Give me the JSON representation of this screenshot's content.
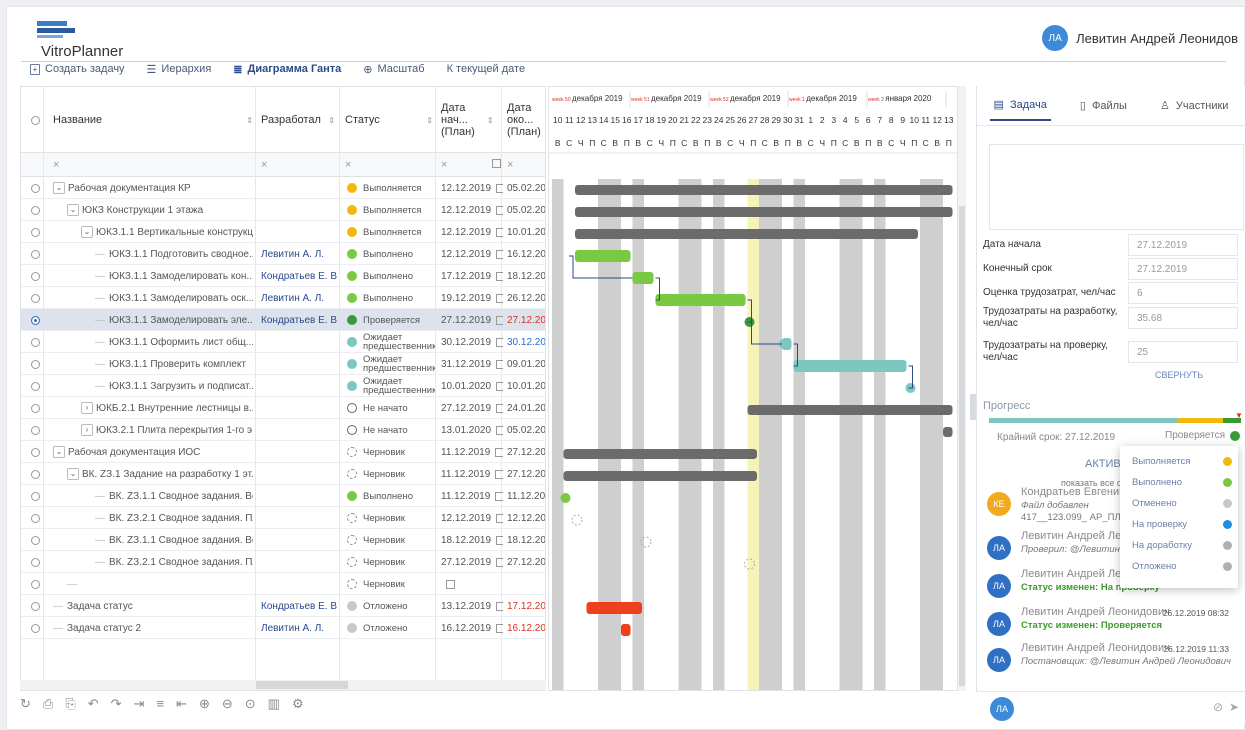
{
  "app": {
    "title": "VitroPlanner"
  },
  "user": {
    "initials": "ЛА",
    "name": "Левитин Андрей Леонидов"
  },
  "toolbar": {
    "create": "Создать задачу",
    "hierarchy": "Иерархия",
    "gantt": "Диаграмма Ганта",
    "scale": "Масштаб",
    "today": "К текущей дате"
  },
  "columns": {
    "name": "Название",
    "author": "Разработал",
    "status": "Статус",
    "start": "Дата нач... (План)",
    "end": "Дата око... (План)"
  },
  "filter_x": "×",
  "colors": {
    "in_progress": "#f2b80f",
    "done": "#7ac943",
    "review": "#3a9a3a",
    "waiting": "#7cc7c0",
    "cancelled": "#c8c8c8",
    "accent": "#2b4a8a",
    "overdue": "#e03020"
  },
  "rows": [
    {
      "name": "Рабочая документация КР",
      "author": "",
      "status": "Выполняется",
      "dot": "in_progress",
      "start": "12.12.2019",
      "end": "05.02.2020",
      "indent": 1,
      "exp": "v"
    },
    {
      "name": "ЮКЗ Конструкции 1 этажа",
      "author": "",
      "status": "Выполняется",
      "dot": "in_progress",
      "start": "12.12.2019",
      "end": "05.02.2020",
      "indent": 2,
      "exp": "v"
    },
    {
      "name": "ЮКЗ.1.1 Вертикальные конструкц...",
      "author": "",
      "status": "Выполняется",
      "dot": "in_progress",
      "start": "12.12.2019",
      "end": "10.01.2020",
      "indent": 3,
      "exp": "v"
    },
    {
      "name": "ЮКЗ.1.1 Подготовить сводное...",
      "author": "Левитин А. Л.",
      "status": "Выполнено",
      "dot": "done",
      "start": "12.12.2019",
      "end": "16.12.2019",
      "indent": 4
    },
    {
      "name": "ЮКЗ.1.1 Замоделировать кон...",
      "author": "Кондратьев Е. В.",
      "status": "Выполнено",
      "dot": "done",
      "start": "17.12.2019",
      "end": "18.12.2019",
      "indent": 4
    },
    {
      "name": "ЮКЗ.1.1 Замоделировать оск...",
      "author": "Левитин А. Л.",
      "status": "Выполнено",
      "dot": "done",
      "start": "19.12.2019",
      "end": "26.12.2019",
      "indent": 4
    },
    {
      "name": "ЮКЗ.1.1 Замоделировать эле...",
      "author": "Кондратьев Е. В.",
      "status": "Проверяется",
      "dot": "review",
      "start": "27.12.2019",
      "end": "27.12.2019",
      "indent": 4,
      "endColor": "red",
      "sel": true
    },
    {
      "name": "ЮКЗ.1.1 Оформить лист общ...",
      "author": "",
      "status": "Ожидает предшественника",
      "dot": "waiting",
      "start": "30.12.2019",
      "end": "30.12.2019",
      "indent": 4,
      "endColor": "blue"
    },
    {
      "name": "ЮКЗ.1.1 Проверить комплект",
      "author": "",
      "status": "Ожидает предшественника",
      "dot": "waiting",
      "start": "31.12.2019",
      "end": "09.01.2020",
      "indent": 4
    },
    {
      "name": "ЮКЗ.1.1 Загрузить и подписат...",
      "author": "",
      "status": "Ожидает предшественника",
      "dot": "waiting",
      "start": "10.01.2020",
      "end": "10.01.2020",
      "indent": 4
    },
    {
      "name": "ЮКБ.2.1 Внутренние лестницы в...",
      "author": "",
      "status": "Не начато",
      "dot": "open",
      "start": "27.12.2019",
      "end": "24.01.2020",
      "indent": 3,
      "exp": ">"
    },
    {
      "name": "ЮКЗ.2.1 Плита перекрытия 1-го э...",
      "author": "",
      "status": "Не начато",
      "dot": "open",
      "start": "13.01.2020",
      "end": "05.02.2020",
      "indent": 3,
      "exp": ">"
    },
    {
      "name": "Рабочая документация ИОС",
      "author": "",
      "status": "Черновик",
      "dot": "draft",
      "start": "11.12.2019",
      "end": "27.12.2019",
      "indent": 1,
      "exp": "v"
    },
    {
      "name": "ВК. ZЗ.1 Задание на разработку 1 эт...",
      "author": "",
      "status": "Черновик",
      "dot": "draft",
      "start": "11.12.2019",
      "end": "27.12.2019",
      "indent": 2,
      "exp": "v"
    },
    {
      "name": "ВК. ZЗ.1.1 Сводное задания. Вер...",
      "author": "",
      "status": "Выполнено",
      "dot": "done",
      "start": "11.12.2019",
      "end": "11.12.2019",
      "indent": 4
    },
    {
      "name": "ВК. ZЗ.2.1 Сводное задания. Пли...",
      "author": "",
      "status": "Черновик",
      "dot": "draft",
      "start": "12.12.2019",
      "end": "12.12.2019",
      "indent": 4
    },
    {
      "name": "ВК. ZЗ.1.1 Сводное задания. Вер ...",
      "author": "",
      "status": "Черновик",
      "dot": "draft",
      "start": "18.12.2019",
      "end": "18.12.2019",
      "indent": 4
    },
    {
      "name": "ВК. ZЗ.2.1 Сводное задания. Пли...",
      "author": "",
      "status": "Черновик",
      "dot": "draft",
      "start": "27.12.2019",
      "end": "27.12.2019",
      "indent": 4
    },
    {
      "name": "",
      "author": "",
      "status": "Черновик",
      "dot": "draft",
      "start": "",
      "end": "",
      "indent": 2
    },
    {
      "name": "Задача статус",
      "author": "Кондратьев Е. В.",
      "status": "Отложено",
      "dot": "cancelled",
      "start": "13.12.2019",
      "end": "17.12.2019",
      "indent": 1,
      "endColor": "red"
    },
    {
      "name": "Задача статус 2",
      "author": "Левитин А. Л.",
      "status": "Отложено",
      "dot": "cancelled",
      "start": "16.12.2019",
      "end": "16.12.2019",
      "indent": 1,
      "endColor": "red"
    }
  ],
  "gantt": {
    "weeks": [
      {
        "wk": "week 50",
        "label": "декабря 2019"
      },
      {
        "wk": "week 51",
        "label": "декабря 2019"
      },
      {
        "wk": "week 52",
        "label": "декабря 2019"
      },
      {
        "wk": "week 1",
        "label": "декабря 2019"
      },
      {
        "wk": "week 2",
        "label": "января 2020"
      }
    ],
    "days": [
      "10",
      "11",
      "12",
      "13",
      "14",
      "15",
      "16",
      "17",
      "18",
      "19",
      "20",
      "21",
      "22",
      "23",
      "24",
      "25",
      "26",
      "27",
      "28",
      "29",
      "30",
      "31",
      "1",
      "2",
      "3",
      "4",
      "5",
      "6",
      "7",
      "8",
      "9",
      "10",
      "11",
      "12",
      "13"
    ],
    "weekdays": [
      "В",
      "С",
      "Ч",
      "П",
      "С",
      "В",
      "П",
      "В",
      "С",
      "Ч",
      "П",
      "С",
      "В",
      "П",
      "В",
      "С",
      "Ч",
      "П",
      "С",
      "В",
      "П",
      "В",
      "С",
      "Ч",
      "П",
      "С",
      "В",
      "П",
      "В",
      "С",
      "Ч",
      "П",
      "С",
      "В",
      "П"
    ]
  },
  "panel": {
    "tabs": [
      "Задача",
      "Файлы",
      "Участники"
    ],
    "fields": [
      {
        "label": "Дата начала",
        "value": "27.12.2019"
      },
      {
        "label": "Конечный срок",
        "value": "27.12.2019"
      },
      {
        "label": "Оценка трудозатрат, чел/час",
        "value": "6"
      },
      {
        "label": "Трудозатраты на разработку, чел/час",
        "value": "35.68"
      },
      {
        "label": "Трудозатраты на проверку, чел/час",
        "value": "25"
      }
    ],
    "collapse": "СВЕРНУТЬ",
    "progress": "Прогресс",
    "deadline": "Крайний срок: 27.12.2019",
    "status": "Проверяется",
    "active": "АКТИВН",
    "show_all": "показать все со",
    "feed": [
      {
        "initials": "КЕ",
        "color": "#f2a91c",
        "name": "Кондратьев Евгений Е",
        "sub": "Файл добавлен",
        "sub2": "417__123.099_ АР_ПЛ.004",
        "date": ""
      },
      {
        "initials": "ЛА",
        "color": "#2f6fc4",
        "name": "Левитин Андрей Леон",
        "sub": "Проверил: @Левитин А",
        "date": ""
      },
      {
        "initials": "ЛА",
        "color": "#2f6fc4",
        "name": "Левитин Андрей Леон",
        "sub": "Статус изменен: На проверку",
        "green": true,
        "date": ""
      },
      {
        "initials": "ЛА",
        "color": "#2f6fc4",
        "name": "Левитин Андрей Леонидович",
        "sub": "Статус изменен: Проверяется",
        "green": true,
        "date": "26.12.2019 08:32"
      },
      {
        "initials": "ЛА",
        "color": "#2f6fc4",
        "name": "Левитин Андрей Леонидович",
        "sub": "Постановщик: @Левитин Андрей Леонидович",
        "date": "26.12.2019 11:33"
      }
    ],
    "composer_initials": "ЛА"
  },
  "status_popup": [
    {
      "label": "Выполняется",
      "color": "#f2b80f"
    },
    {
      "label": "Выполнено",
      "color": "#7ac943"
    },
    {
      "label": "Отменено",
      "color": "#c8c8c8"
    },
    {
      "label": "На проверку",
      "color": "#1f8ee0"
    },
    {
      "label": "На доработку",
      "color": "#b0b0b0"
    },
    {
      "label": "Отложено",
      "color": "#b0b0b0"
    }
  ]
}
